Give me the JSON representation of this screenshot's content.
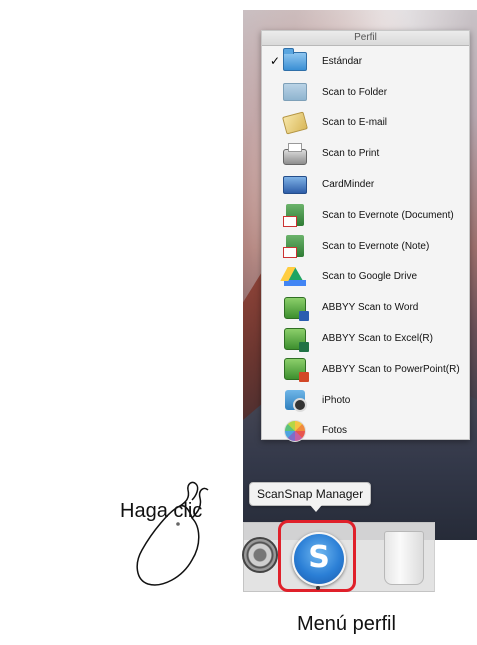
{
  "menu": {
    "title": "Perfil",
    "items": [
      {
        "label": "Estándar",
        "checked": "✓",
        "icon": "folder-blue-icon"
      },
      {
        "label": "Scan to Folder",
        "icon": "folder-icon"
      },
      {
        "label": "Scan to E-mail",
        "icon": "email-icon"
      },
      {
        "label": "Scan to Print",
        "icon": "printer-icon"
      },
      {
        "label": "CardMinder",
        "icon": "cardminder-icon"
      },
      {
        "label": "Scan to Evernote (Document)",
        "icon": "evernote-pdf-icon"
      },
      {
        "label": "Scan to Evernote (Note)",
        "icon": "evernote-jpg-icon"
      },
      {
        "label": "Scan to Google Drive",
        "icon": "google-drive-icon"
      },
      {
        "label": "ABBYY Scan to Word",
        "icon": "abbyy-word-icon"
      },
      {
        "label": "ABBYY Scan to Excel(R)",
        "icon": "abbyy-excel-icon"
      },
      {
        "label": "ABBYY Scan to PowerPoint(R)",
        "icon": "abbyy-powerpoint-icon"
      },
      {
        "label": "iPhoto",
        "icon": "iphoto-icon"
      },
      {
        "label": "Fotos",
        "icon": "photos-icon"
      }
    ]
  },
  "tooltip": "ScanSnap Manager",
  "scansnap_glyph": "S",
  "callout": "Haga clic",
  "caption": "Menú perfil",
  "colors": {
    "highlight": "#e0202a",
    "scansnap_blue": "#2b7fd6"
  }
}
